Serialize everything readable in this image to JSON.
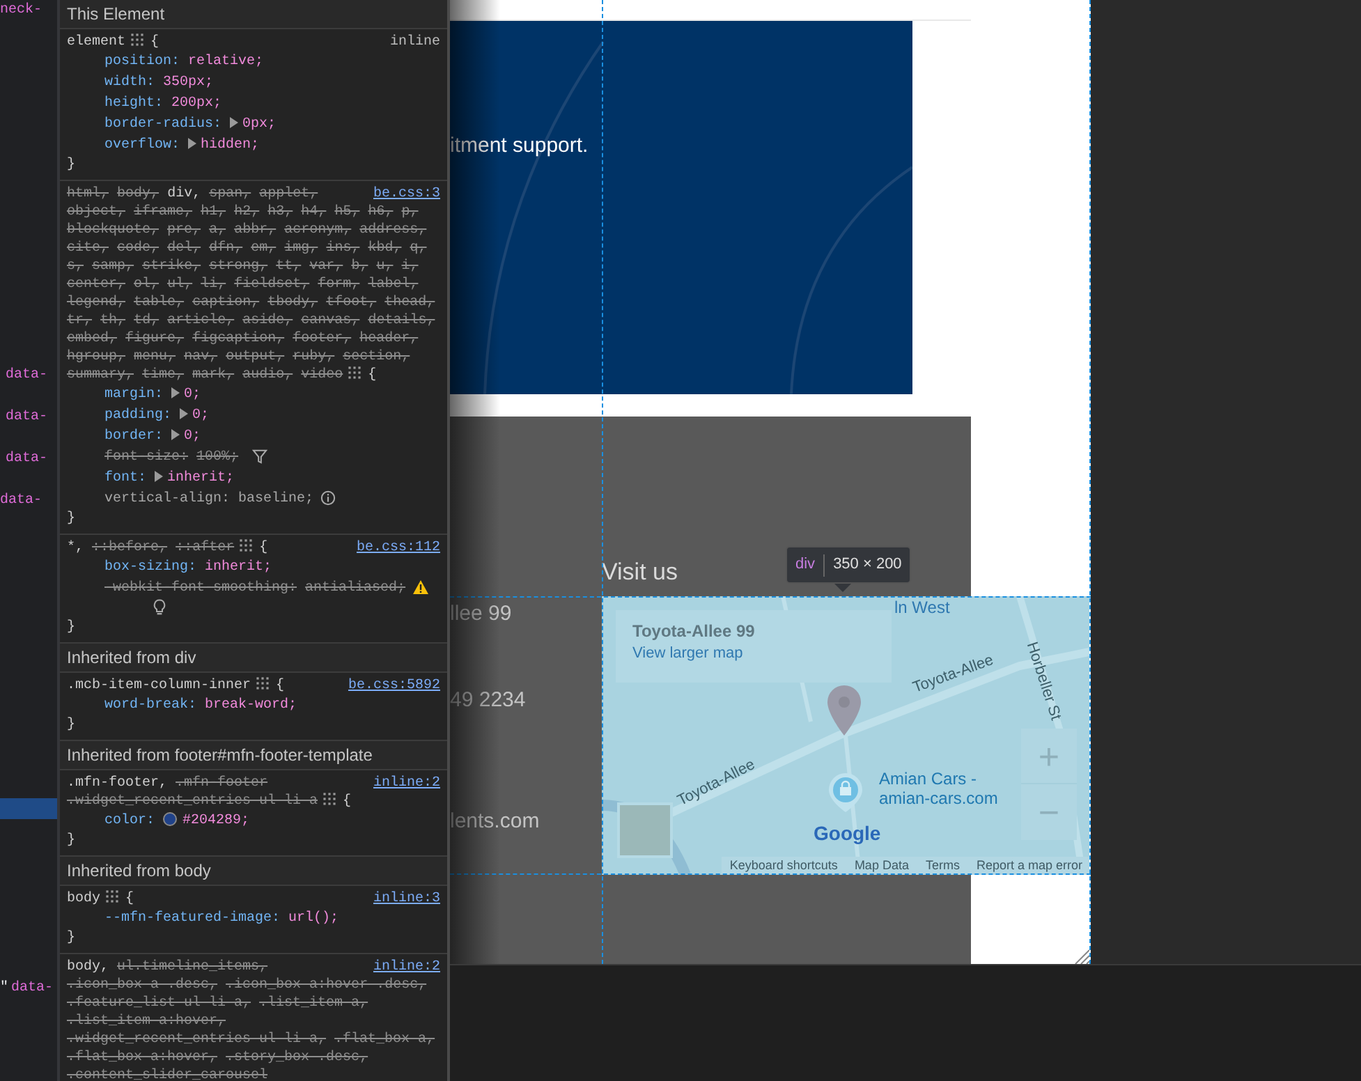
{
  "dom_tree": {
    "rows": [
      {
        "text": "neck-",
        "selected": false
      },
      {
        "text": "data-",
        "selected": false
      },
      {
        "text": "data-",
        "selected": false
      },
      {
        "text": "data-",
        "selected": false
      },
      {
        "text": "data-",
        "selected": false
      },
      {
        "selected": true
      },
      {
        "quote": "\"",
        "text": "data-",
        "selected": false
      }
    ]
  },
  "styles": {
    "sections": [
      {
        "kind": "header",
        "text": "This Element"
      },
      {
        "kind": "rule",
        "selector": [
          {
            "text": "element",
            "struck": false
          }
        ],
        "layout_icon": true,
        "open": "{",
        "close": "}",
        "source": "inline",
        "source_link": false,
        "hint_icon": false,
        "properties": [
          {
            "name": "position:",
            "value": "relative;",
            "expandable": false,
            "struck": false,
            "kind": "normal"
          },
          {
            "name": "width:",
            "value": "350px;",
            "expandable": false,
            "struck": false,
            "kind": "normal"
          },
          {
            "name": "height:",
            "value": "200px;",
            "expandable": false,
            "struck": false,
            "kind": "normal"
          },
          {
            "name": "border-radius:",
            "value": "0px;",
            "expandable": true,
            "struck": false,
            "kind": "normal"
          },
          {
            "name": "overflow:",
            "value": "hidden;",
            "expandable": true,
            "struck": false,
            "kind": "normal"
          }
        ]
      },
      {
        "kind": "rule",
        "selector": [
          {
            "text": "html,",
            "struck": true
          },
          {
            "text": "body,",
            "struck": true
          },
          {
            "text": "div,",
            "struck": false
          },
          {
            "text": "span,",
            "struck": true
          },
          {
            "text": "applet,",
            "struck": true
          },
          {
            "text": "object,",
            "struck": true
          },
          {
            "text": "iframe,",
            "struck": true
          },
          {
            "text": "h1,",
            "struck": true
          },
          {
            "text": "h2,",
            "struck": true
          },
          {
            "text": "h3,",
            "struck": true
          },
          {
            "text": "h4,",
            "struck": true
          },
          {
            "text": "h5,",
            "struck": true
          },
          {
            "text": "h6,",
            "struck": true
          },
          {
            "text": "p,",
            "struck": true
          },
          {
            "text": "blockquote,",
            "struck": true
          },
          {
            "text": "pre,",
            "struck": true
          },
          {
            "text": "a,",
            "struck": true
          },
          {
            "text": "abbr,",
            "struck": true
          },
          {
            "text": "acronym,",
            "struck": true
          },
          {
            "text": "address,",
            "struck": true
          },
          {
            "text": "cite,",
            "struck": true
          },
          {
            "text": "code,",
            "struck": true
          },
          {
            "text": "del,",
            "struck": true
          },
          {
            "text": "dfn,",
            "struck": true
          },
          {
            "text": "em,",
            "struck": true
          },
          {
            "text": "img,",
            "struck": true
          },
          {
            "text": "ins,",
            "struck": true
          },
          {
            "text": "kbd,",
            "struck": true
          },
          {
            "text": "q,",
            "struck": true
          },
          {
            "text": "s,",
            "struck": true
          },
          {
            "text": "samp,",
            "struck": true
          },
          {
            "text": "strike,",
            "struck": true
          },
          {
            "text": "strong,",
            "struck": true
          },
          {
            "text": "tt,",
            "struck": true
          },
          {
            "text": "var,",
            "struck": true
          },
          {
            "text": "b,",
            "struck": true
          },
          {
            "text": "u,",
            "struck": true
          },
          {
            "text": "i,",
            "struck": true
          },
          {
            "text": "center,",
            "struck": true
          },
          {
            "text": "ol,",
            "struck": true
          },
          {
            "text": "ul,",
            "struck": true
          },
          {
            "text": "li,",
            "struck": true
          },
          {
            "text": "fieldset,",
            "struck": true
          },
          {
            "text": "form,",
            "struck": true
          },
          {
            "text": "label,",
            "struck": true
          },
          {
            "text": "legend,",
            "struck": true
          },
          {
            "text": "table,",
            "struck": true
          },
          {
            "text": "caption,",
            "struck": true
          },
          {
            "text": "tbody,",
            "struck": true
          },
          {
            "text": "tfoot,",
            "struck": true
          },
          {
            "text": "thead,",
            "struck": true
          },
          {
            "text": "tr,",
            "struck": true
          },
          {
            "text": "th,",
            "struck": true
          },
          {
            "text": "td,",
            "struck": true
          },
          {
            "text": "article,",
            "struck": true
          },
          {
            "text": "aside,",
            "struck": true
          },
          {
            "text": "canvas,",
            "struck": true
          },
          {
            "text": "details,",
            "struck": true
          },
          {
            "text": "embed,",
            "struck": true
          },
          {
            "text": "figure,",
            "struck": true
          },
          {
            "text": "figcaption,",
            "struck": true
          },
          {
            "text": "footer,",
            "struck": true
          },
          {
            "text": "header,",
            "struck": true
          },
          {
            "text": "hgroup,",
            "struck": true
          },
          {
            "text": "menu,",
            "struck": true
          },
          {
            "text": "nav,",
            "struck": true
          },
          {
            "text": "output,",
            "struck": true
          },
          {
            "text": "ruby,",
            "struck": true
          },
          {
            "text": "section,",
            "struck": true
          },
          {
            "text": "summary,",
            "struck": true
          },
          {
            "text": "time,",
            "struck": true
          },
          {
            "text": "mark,",
            "struck": true
          },
          {
            "text": "audio,",
            "struck": true
          },
          {
            "text": "video",
            "struck": true
          }
        ],
        "layout_icon": true,
        "open": "{",
        "close": "}",
        "source": "be.css:3",
        "source_link": true,
        "hint_icon": false,
        "properties": [
          {
            "name": "margin:",
            "value": "0;",
            "expandable": true,
            "struck": false,
            "kind": "normal"
          },
          {
            "name": "padding:",
            "value": "0;",
            "expandable": true,
            "struck": false,
            "kind": "normal"
          },
          {
            "name": "border:",
            "value": "0;",
            "expandable": true,
            "struck": false,
            "kind": "normal"
          },
          {
            "name": "font-size:",
            "value": "100%;",
            "expandable": false,
            "struck": true,
            "kind": "overridden"
          },
          {
            "name": "font:",
            "value": "inherit;",
            "expandable": true,
            "struck": false,
            "kind": "normal"
          },
          {
            "name": "vertical-align:",
            "value": "baseline;",
            "expandable": false,
            "struck": false,
            "kind": "inactive"
          }
        ]
      },
      {
        "kind": "rule",
        "selector": [
          {
            "text": "*,",
            "struck": false
          },
          {
            "text": "::before,",
            "struck": true
          },
          {
            "text": "::after",
            "struck": true
          }
        ],
        "layout_icon": true,
        "open": "{",
        "close": "}",
        "source": "be.css:112",
        "source_link": true,
        "hint_icon": true,
        "properties": [
          {
            "name": "box-sizing:",
            "value": "inherit;",
            "expandable": false,
            "struck": false,
            "kind": "normal"
          },
          {
            "name": "-webkit-font-smoothing:",
            "value": "antialiased;",
            "expandable": false,
            "struck": true,
            "kind": "invalid"
          }
        ]
      },
      {
        "kind": "header",
        "text": "Inherited from div"
      },
      {
        "kind": "rule",
        "selector": [
          {
            "text": ".mcb-item-column-inner",
            "struck": false
          }
        ],
        "layout_icon": true,
        "open": "{",
        "close": "}",
        "source": "be.css:5892",
        "source_link": true,
        "hint_icon": false,
        "properties": [
          {
            "name": "word-break:",
            "value": "break-word;",
            "expandable": false,
            "struck": false,
            "kind": "normal"
          }
        ]
      },
      {
        "kind": "header",
        "text": "Inherited from footer#mfn-footer-template"
      },
      {
        "kind": "rule",
        "selector": [
          {
            "text": ".mfn-footer,",
            "struck": false
          },
          {
            "text": ".mfn-footer",
            "struck": true
          },
          {
            "text": ".widget_recent_entries ul li a",
            "struck": true
          }
        ],
        "layout_icon": true,
        "open": "{",
        "close": "}",
        "source": "inline:2",
        "source_link": true,
        "hint_icon": false,
        "properties": [
          {
            "name": "color:",
            "value": "#204289;",
            "expandable": false,
            "struck": false,
            "kind": "normal",
            "color": "#204289"
          }
        ]
      },
      {
        "kind": "header",
        "text": "Inherited from body"
      },
      {
        "kind": "rule",
        "selector": [
          {
            "text": "body",
            "struck": false
          }
        ],
        "layout_icon": true,
        "open": "{",
        "close": "}",
        "source": "inline:3",
        "source_link": true,
        "hint_icon": false,
        "properties": [
          {
            "name": "--mfn-featured-image:",
            "value": "url();",
            "expandable": false,
            "struck": false,
            "kind": "normal"
          }
        ]
      },
      {
        "kind": "rule",
        "selector": [
          {
            "text": "body,",
            "struck": false
          },
          {
            "text": "ul.timeline_items,",
            "struck": true
          },
          {
            "text": ".icon_box a .desc,",
            "struck": true
          },
          {
            "text": ".icon_box a:hover .desc,",
            "struck": true
          },
          {
            "text": ".feature_list ul li a,",
            "struck": true
          },
          {
            "text": ".list_item a,",
            "struck": true
          },
          {
            "text": ".list_item a:hover,",
            "struck": true
          },
          {
            "text": ".widget_recent_entries ul li a,",
            "struck": true
          },
          {
            "text": ".flat_box a,",
            "struck": true
          },
          {
            "text": ".flat_box a:hover,",
            "struck": true
          },
          {
            "text": ".story_box .desc,",
            "struck": true
          },
          {
            "text": ".content_slider_carousel",
            "struck": true
          }
        ],
        "layout_icon": false,
        "source": "inline:2",
        "source_link": true,
        "hint_icon": false
      }
    ]
  },
  "page": {
    "hero": {
      "text": "itment support."
    },
    "footer": {
      "heading": "Visit us",
      "lines": [
        "llee 99",
        "49 2234",
        "lents.com"
      ]
    },
    "map": {
      "place_card": {
        "title": "Toyota-Allee 99",
        "link": "View larger map"
      },
      "top_label": "ln West",
      "street_labels": [
        "Toyota-Allee",
        "Toyota-Allee",
        "Horbeller St"
      ],
      "poi": {
        "name": "Amian Cars -",
        "site": "amian-cars.com"
      },
      "zoom": {
        "in": "+",
        "out": "−"
      },
      "logo": "Google",
      "footer_links": [
        "Keyboard shortcuts",
        "Map Data",
        "Terms",
        "Report a map error"
      ]
    },
    "inspect_tooltip": {
      "tag": "div",
      "size": "350 × 200"
    }
  }
}
